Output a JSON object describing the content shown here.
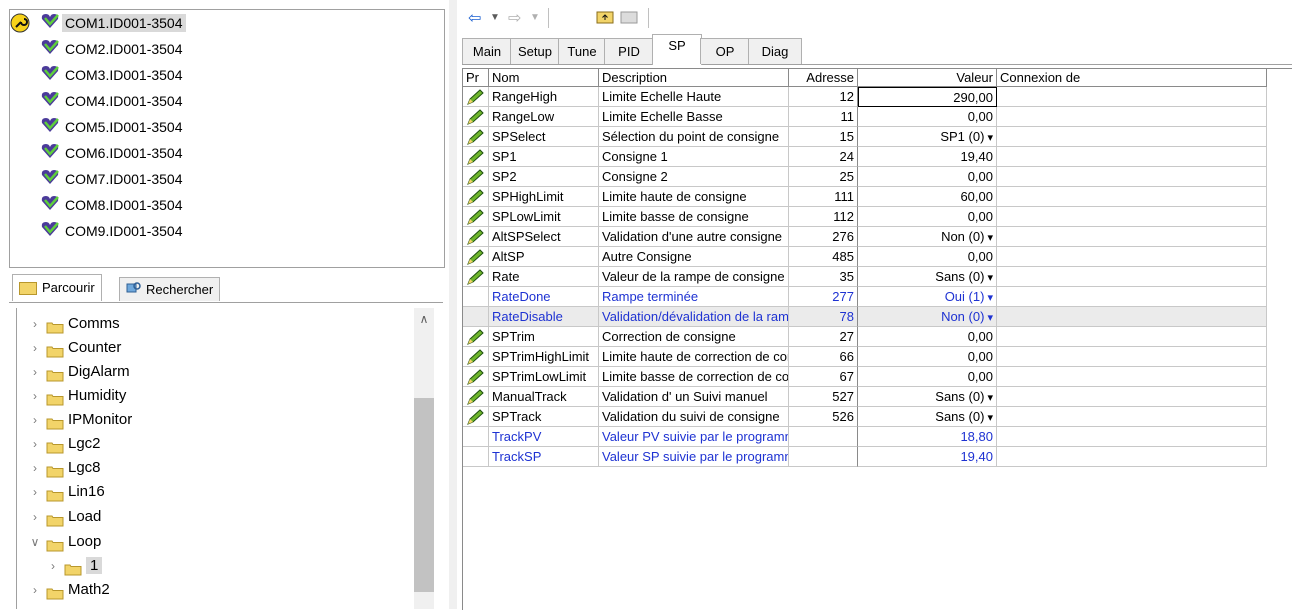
{
  "devices": [
    {
      "label": "COM1.ID001-3504",
      "selected": true
    },
    {
      "label": "COM2.ID001-3504",
      "selected": false
    },
    {
      "label": "COM3.ID001-3504",
      "selected": false
    },
    {
      "label": "COM4.ID001-3504",
      "selected": false
    },
    {
      "label": "COM5.ID001-3504",
      "selected": false
    },
    {
      "label": "COM6.ID001-3504",
      "selected": false
    },
    {
      "label": "COM7.ID001-3504",
      "selected": false
    },
    {
      "label": "COM8.ID001-3504",
      "selected": false
    },
    {
      "label": "COM9.ID001-3504",
      "selected": false
    }
  ],
  "left_tabs": {
    "browse": "Parcourir",
    "search": "Rechercher"
  },
  "tree": [
    {
      "label": "Comms",
      "expanded": false
    },
    {
      "label": "Counter",
      "expanded": false
    },
    {
      "label": "DigAlarm",
      "expanded": false
    },
    {
      "label": "Humidity",
      "expanded": false
    },
    {
      "label": "IPMonitor",
      "expanded": false
    },
    {
      "label": "Lgc2",
      "expanded": false
    },
    {
      "label": "Lgc8",
      "expanded": false
    },
    {
      "label": "Lin16",
      "expanded": false
    },
    {
      "label": "Load",
      "expanded": false
    },
    {
      "label": "Loop",
      "expanded": true
    },
    {
      "label": "1",
      "expanded": false,
      "child": true,
      "selected": true
    },
    {
      "label": "Math2",
      "expanded": false
    }
  ],
  "tabs": [
    "Main",
    "Setup",
    "Tune",
    "PID",
    "SP",
    "OP",
    "Diag"
  ],
  "active_tab": "SP",
  "columns": {
    "pr": "Pr",
    "name": "Nom",
    "description": "Description",
    "address": "Adresse",
    "value": "Valeur",
    "connection": "Connexion de"
  },
  "rows": [
    {
      "name": "RangeHigh",
      "description": "Limite Echelle Haute",
      "address": "12",
      "value": "290,00",
      "editable": true
    },
    {
      "name": "RangeLow",
      "description": "Limite Echelle Basse",
      "address": "11",
      "value": "0,00",
      "editable": true
    },
    {
      "name": "SPSelect",
      "description": "Sélection du point de consigne",
      "address": "15",
      "value": "SP1 (0)",
      "dropdown": true,
      "editable": true
    },
    {
      "name": "SP1",
      "description": "Consigne 1",
      "address": "24",
      "value": "19,40",
      "editable": true
    },
    {
      "name": "SP2",
      "description": "Consigne 2",
      "address": "25",
      "value": "0,00",
      "editable": true
    },
    {
      "name": "SPHighLimit",
      "description": "Limite haute de consigne",
      "address": "111",
      "value": "60,00",
      "editable": true
    },
    {
      "name": "SPLowLimit",
      "description": "Limite basse de consigne",
      "address": "112",
      "value": "0,00",
      "editable": true
    },
    {
      "name": "AltSPSelect",
      "description": "Validation d'une autre consigne",
      "address": "276",
      "value": "Non (0)",
      "dropdown": true,
      "editable": true
    },
    {
      "name": "AltSP",
      "description": "Autre Consigne",
      "address": "485",
      "value": "0,00",
      "editable": true
    },
    {
      "name": "Rate",
      "description": "Valeur de la rampe de consigne",
      "address": "35",
      "value": "Sans (0)",
      "dropdown": true,
      "editable": true
    },
    {
      "name": "RateDone",
      "description": "Rampe terminée",
      "address": "277",
      "value": "Oui (1)",
      "dropdown": true,
      "editable": false
    },
    {
      "name": "RateDisable",
      "description": "Validation/dévalidation de la rampe",
      "address": "78",
      "value": "Non (0)",
      "dropdown": true,
      "editable": false,
      "highlight": true
    },
    {
      "name": "SPTrim",
      "description": "Correction de consigne",
      "address": "27",
      "value": "0,00",
      "editable": true
    },
    {
      "name": "SPTrimHighLimit",
      "description": "Limite haute de correction de consigne",
      "address": "66",
      "value": "0,00",
      "editable": true
    },
    {
      "name": "SPTrimLowLimit",
      "description": "Limite basse de correction de consigne",
      "address": "67",
      "value": "0,00",
      "editable": true
    },
    {
      "name": "ManualTrack",
      "description": "Validation d' un Suivi manuel",
      "address": "527",
      "value": "Sans (0)",
      "dropdown": true,
      "editable": true
    },
    {
      "name": "SPTrack",
      "description": "Validation du suivi de consigne",
      "address": "526",
      "value": "Sans (0)",
      "dropdown": true,
      "editable": true
    },
    {
      "name": "TrackPV",
      "description": "Valeur PV suivie par le programme",
      "address": "",
      "value": "18,80",
      "editable": false
    },
    {
      "name": "TrackSP",
      "description": "Valeur SP suivie par le programme",
      "address": "",
      "value": "19,40",
      "editable": false
    }
  ],
  "colors": {
    "readonly_text": "#1e32d2",
    "device_icon": "#4b3b9a",
    "folder": "#f2d469"
  }
}
